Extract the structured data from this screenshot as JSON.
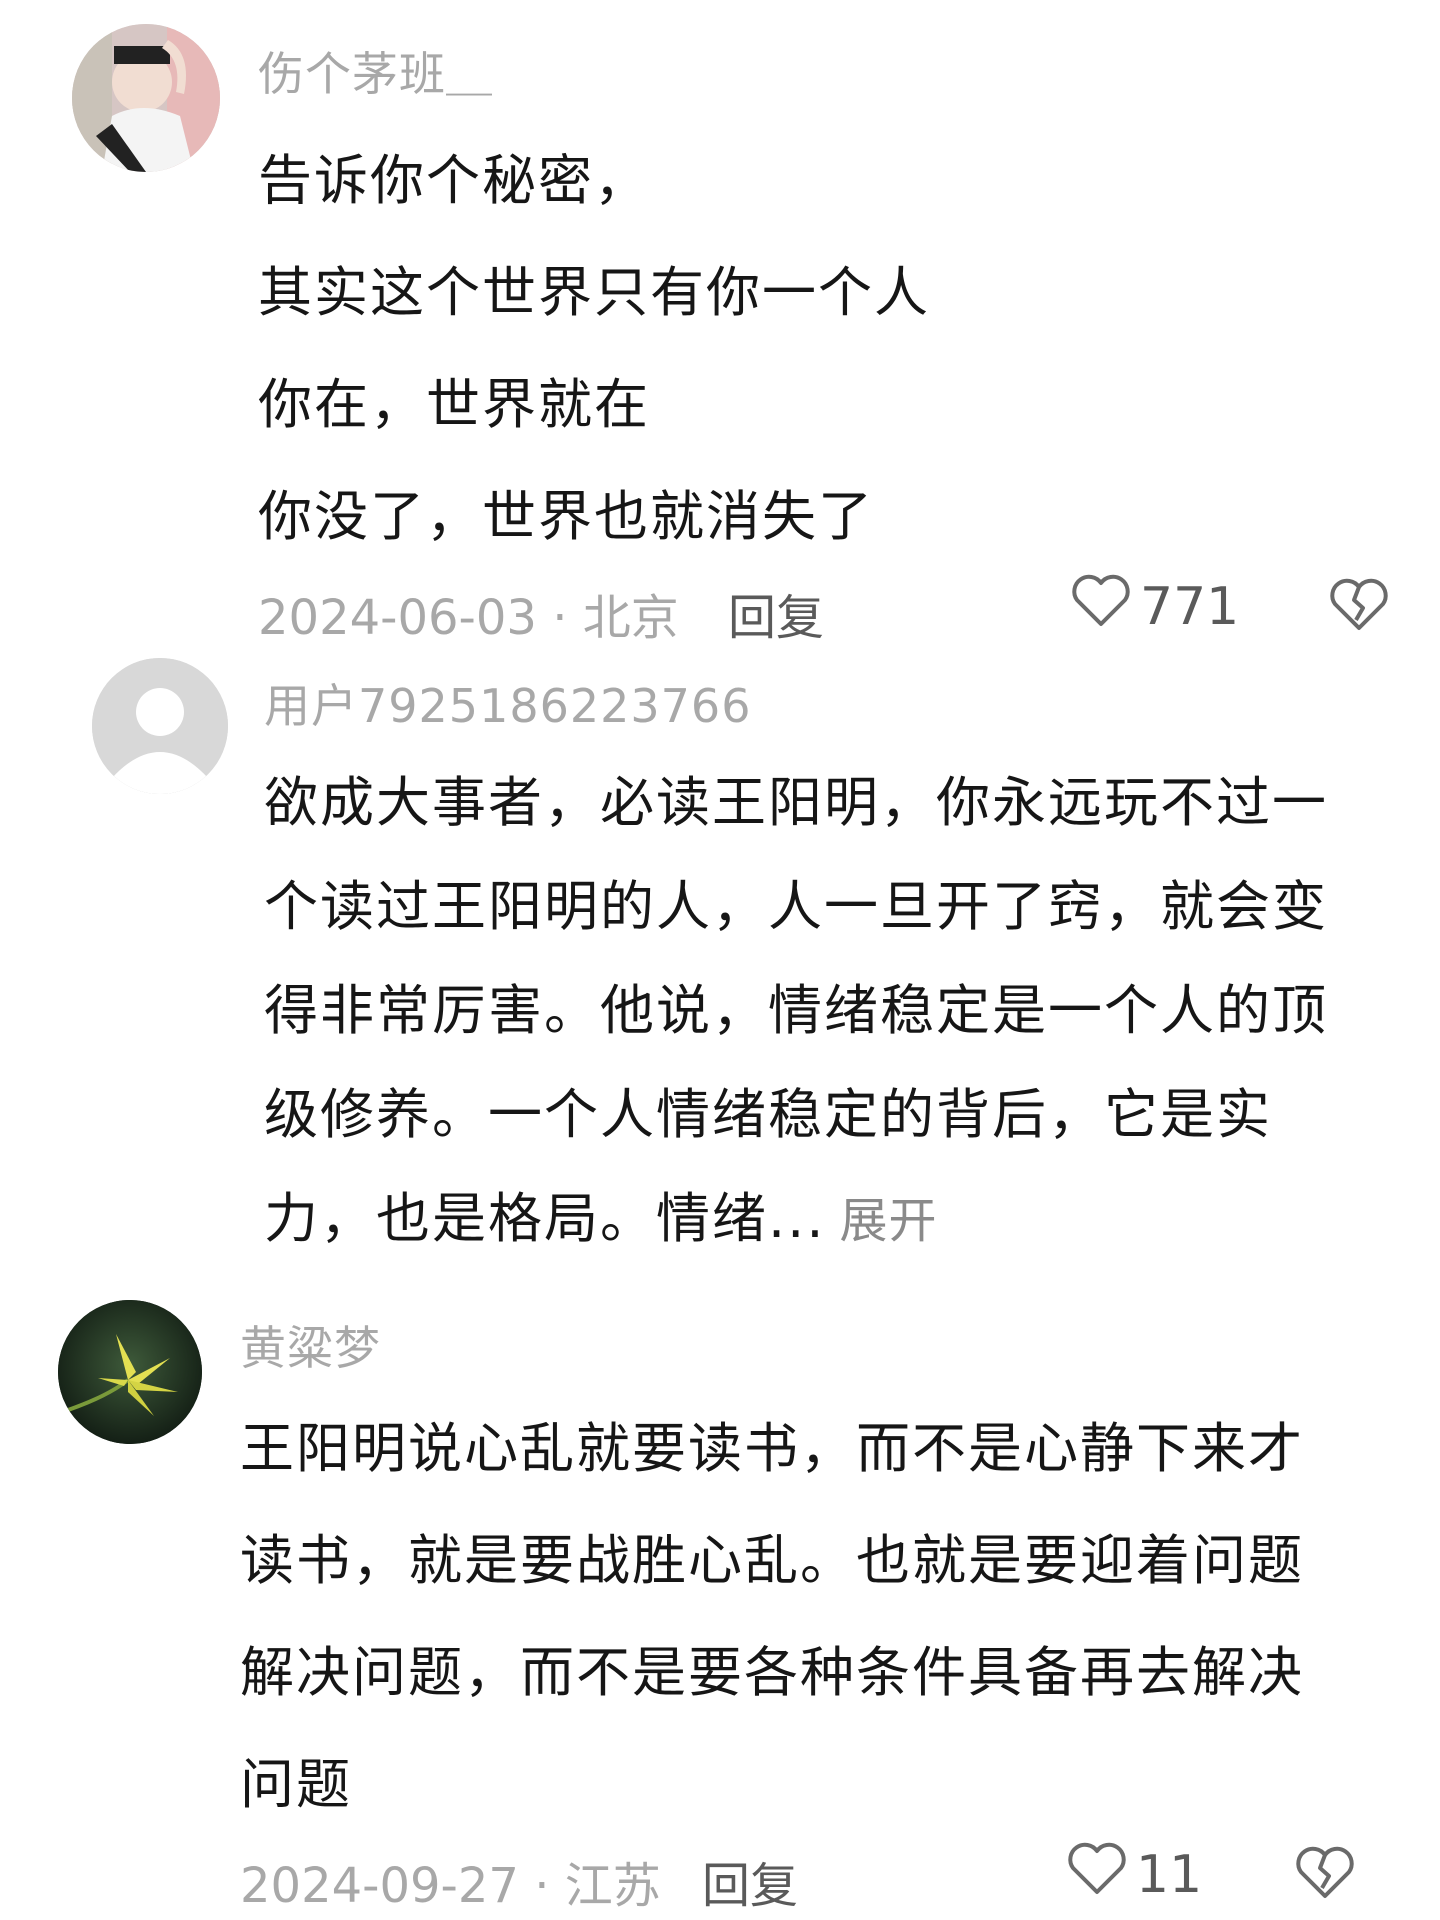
{
  "comments": [
    {
      "username": "伤个茅班＿",
      "lines": [
        "告诉你个秘密，",
        "其实这个世界只有你一个人",
        "你在，世界就在",
        "你没了，世界也就消失了"
      ],
      "meta": "2024-06-03 · 北京",
      "reply_label": "回复",
      "likes": "771",
      "avatar_icon": "user-photo-avatar",
      "like_icon": "heart-outline-icon",
      "dislike_icon": "broken-heart-icon"
    },
    {
      "username": "用户7925186223766",
      "lines": [
        "欲成大事者，必读王阳明，你永远玩不过一",
        "个读过王阳明的人，人一旦开了窍，就会变",
        "得非常厉害。他说，情绪稳定是一个人的顶",
        "级修养。一个人情绪稳定的背后，它是实",
        "力，也是格局。情绪..."
      ],
      "expand_label": "展开",
      "avatar_icon": "default-user-avatar"
    },
    {
      "username": "黄粱梦",
      "lines": [
        "王阳明说心乱就要读书，而不是心静下来才",
        "读书，就是要战胜心乱。也就是要迎着问题",
        "解决问题，而不是要各种条件具备再去解决",
        "问题"
      ],
      "meta": "2024-09-27 · 江苏",
      "reply_label": "回复",
      "likes": "11",
      "avatar_icon": "flower-avatar",
      "like_icon": "heart-outline-icon",
      "dislike_icon": "broken-heart-icon"
    }
  ],
  "colors": {
    "username": "#a8a8a8",
    "text": "#161616",
    "meta": "#a8a8a8",
    "action": "#5a5a5a"
  }
}
